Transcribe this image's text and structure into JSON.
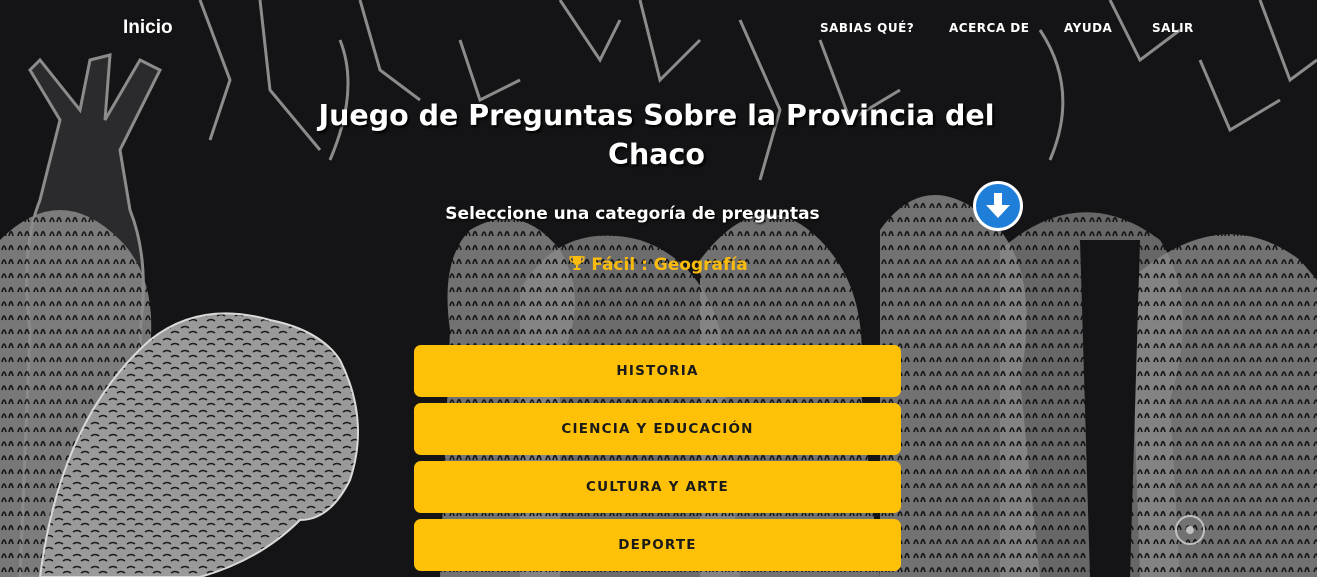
{
  "nav": {
    "brand": "Inicio",
    "links": [
      "SABIAS QUÉ?",
      "ACERCA DE",
      "AYUDA",
      "SALIR"
    ]
  },
  "header": {
    "title": "Juego de Preguntas Sobre la Provincia del Chaco",
    "subtitle": "Seleccione una categoría de preguntas",
    "scroll_button_icon": "arrow-down-circle-icon"
  },
  "level": {
    "icon": "trophy-icon",
    "text": "Fácil : Geografía"
  },
  "categories": [
    "HISTORIA",
    "CIENCIA Y EDUCACIÓN",
    "CULTURA Y ARTE",
    "DEPORTE"
  ],
  "colors": {
    "background": "#141416",
    "illustration": "#8f8f8f",
    "accent_yellow": "#fec107",
    "level_text": "#fcbc0c",
    "scroll_button_blue": "#1f7fd8"
  },
  "background": {
    "description_icon": "forest-jaguar-illustration"
  }
}
